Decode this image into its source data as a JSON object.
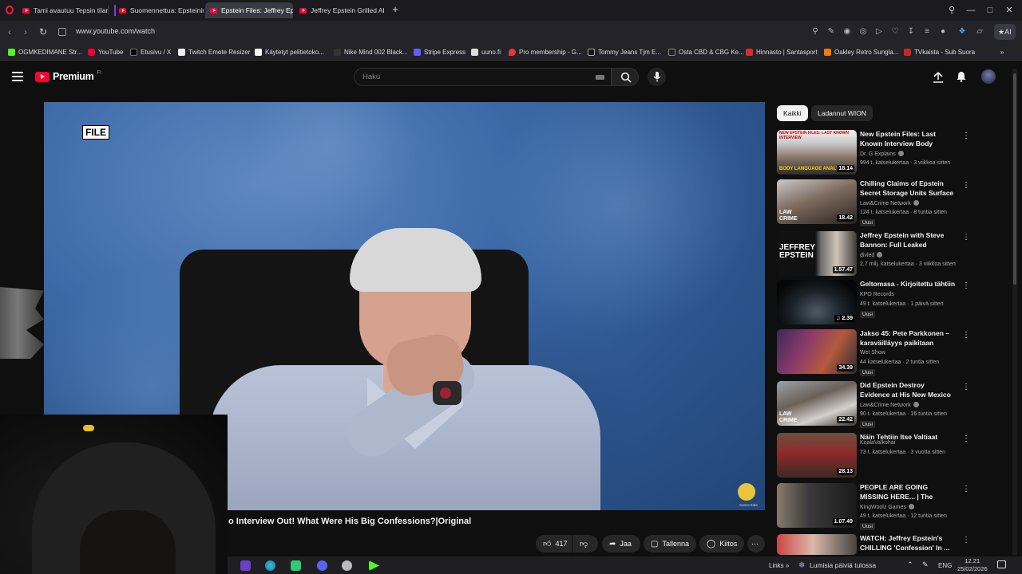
{
  "browser": {
    "tabs": [
      {
        "label": "Tami avautuu Tepsin tilan"
      },
      {
        "label": "Suomennettua: Epsteinin"
      },
      {
        "label": "Epstein Files: Jeffrey Epst"
      },
      {
        "label": "Jeffrey Epstein Grilled Abo"
      }
    ],
    "url": "www.youtube.com/watch",
    "ai_label": "AI",
    "bookmarks": [
      {
        "label": "OGMKEDIMANE Str..."
      },
      {
        "label": "YouTube"
      },
      {
        "label": "Etusivu / X"
      },
      {
        "label": "Twitch Emote Resizer"
      },
      {
        "label": "Käytetyt pelitietoko..."
      },
      {
        "label": "Nike Mind 002 Black..."
      },
      {
        "label": "Stripe Express"
      },
      {
        "label": "uuno.fi"
      },
      {
        "label": "Pro membership - G..."
      },
      {
        "label": "Tommy Jeans Tjm E..."
      },
      {
        "label": "Osta CBD & CBG Ke..."
      },
      {
        "label": "Hinnasto | Santasport"
      },
      {
        "label": "Oakley Retro Sungla..."
      },
      {
        "label": "TVkaista - Sub Suora"
      }
    ]
  },
  "youtube": {
    "logo_text": "Premium",
    "logo_region": "FI",
    "search_placeholder": "Haku"
  },
  "video": {
    "file_badge": "FILE",
    "subscribe_text": "SUBSCRIBE",
    "title": "o Interview Out! What Were His Big Confessions?|Original",
    "likes": "417",
    "share_label": "Jaa",
    "save_label": "Tallenna",
    "thanks_label": "Kiitos",
    "more_label": "⋯"
  },
  "sidebar": {
    "chips": [
      {
        "label": "Kaikki",
        "active": true
      },
      {
        "label": "Ladannut WION",
        "active": false
      }
    ],
    "items": [
      {
        "title": "New Epstein Files: Last Known Interview Body Language ...",
        "channel": "Dr. G Explains",
        "meta": "994 t. katselukertaa · 3 viikkoa sitten",
        "duration": "18.14",
        "thumb_top": "NEW EPSTEIN FILES: LAST KNOWN INTERVIEW",
        "thumb_bottom": "BODY LANGUAGE ANALYSIS",
        "verified": true,
        "new": false
      },
      {
        "title": "Chilling Claims of Epstein Secret Storage Units Surface",
        "channel": "Law&Crime Network",
        "meta": "124 t. katselukertaa · 8 tuntia sitten",
        "duration": "18.42",
        "thumb_top": "",
        "thumb_bottom": "LAW CRIME",
        "verified": true,
        "new": true
      },
      {
        "title": "Jeffrey Epstein with Steve Bannon: Full Leaked Interview",
        "channel": "divled",
        "meta": "2,7 milj. katselukertaa · 3 viikkoa sitten",
        "duration": "1.57.47",
        "thumb_top": "JEFFREY EPSTEIN",
        "thumb_bottom": "",
        "verified": true,
        "new": false
      },
      {
        "title": "Geltomasa - Kirjoitettu tähtiin",
        "channel": "KPO Records",
        "meta": "49 t. katselukertaa · 1 päivä sitten",
        "duration": "2.39",
        "thumb_top": "",
        "thumb_bottom": "",
        "verified": false,
        "new": true
      },
      {
        "title": "Jakso 45: Pete Parkkonen – karaväilläyys paikitaan",
        "channel": "Wet Show",
        "meta": "44 katselukertaa · 2 tuntia sitten",
        "duration": "34.39",
        "thumb_top": "",
        "thumb_bottom": "",
        "verified": false,
        "new": true
      },
      {
        "title": "Did Epstein Destroy Evidence at His New Mexico Ranch?",
        "channel": "Law&Crime Network",
        "meta": "90 t. katselukertaa · 16 tuntia sitten",
        "duration": "22.42",
        "thumb_top": "",
        "thumb_bottom": "LAW CRIME",
        "verified": true,
        "new": true
      },
      {
        "title": "Näin Tehtiin Itse Valtiaat",
        "channel": "KoalaValkohai",
        "meta": "73 t. katselukertaa · 3 vuotta sitten",
        "duration": "28.13",
        "thumb_top": "",
        "thumb_bottom": "",
        "verified": false,
        "new": false
      },
      {
        "title": "PEOPLE ARE GOING MISSING HERE... | The Stalking Stairs",
        "channel": "KingWoolz Games",
        "meta": "49 t. katselukertaa · 12 tuntia sitten",
        "duration": "1.07.49",
        "thumb_top": "",
        "thumb_bottom": "",
        "verified": true,
        "new": true
      },
      {
        "title": "WATCH: Jeffrey Epstein's CHILLING 'Confession' In ...",
        "channel": "",
        "meta": "",
        "duration": "",
        "thumb_top": "",
        "thumb_bottom": "",
        "verified": false,
        "new": false
      }
    ]
  },
  "taskbar": {
    "links_label": "Links",
    "weather": "Lumisia päiviä tulossa",
    "lang": "ENG",
    "time": "12.21",
    "date": "25/02/2026"
  }
}
